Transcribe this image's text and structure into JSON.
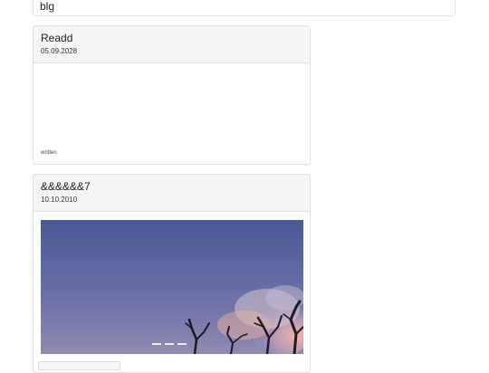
{
  "site": {
    "title": "blg"
  },
  "posts": [
    {
      "title": "Readd",
      "date": "05.09.2028",
      "body": "written"
    },
    {
      "title": "&&&&&&7",
      "date": "10.10.2010"
    }
  ],
  "carousel": {
    "slide_count": 3,
    "active_index": 0
  }
}
